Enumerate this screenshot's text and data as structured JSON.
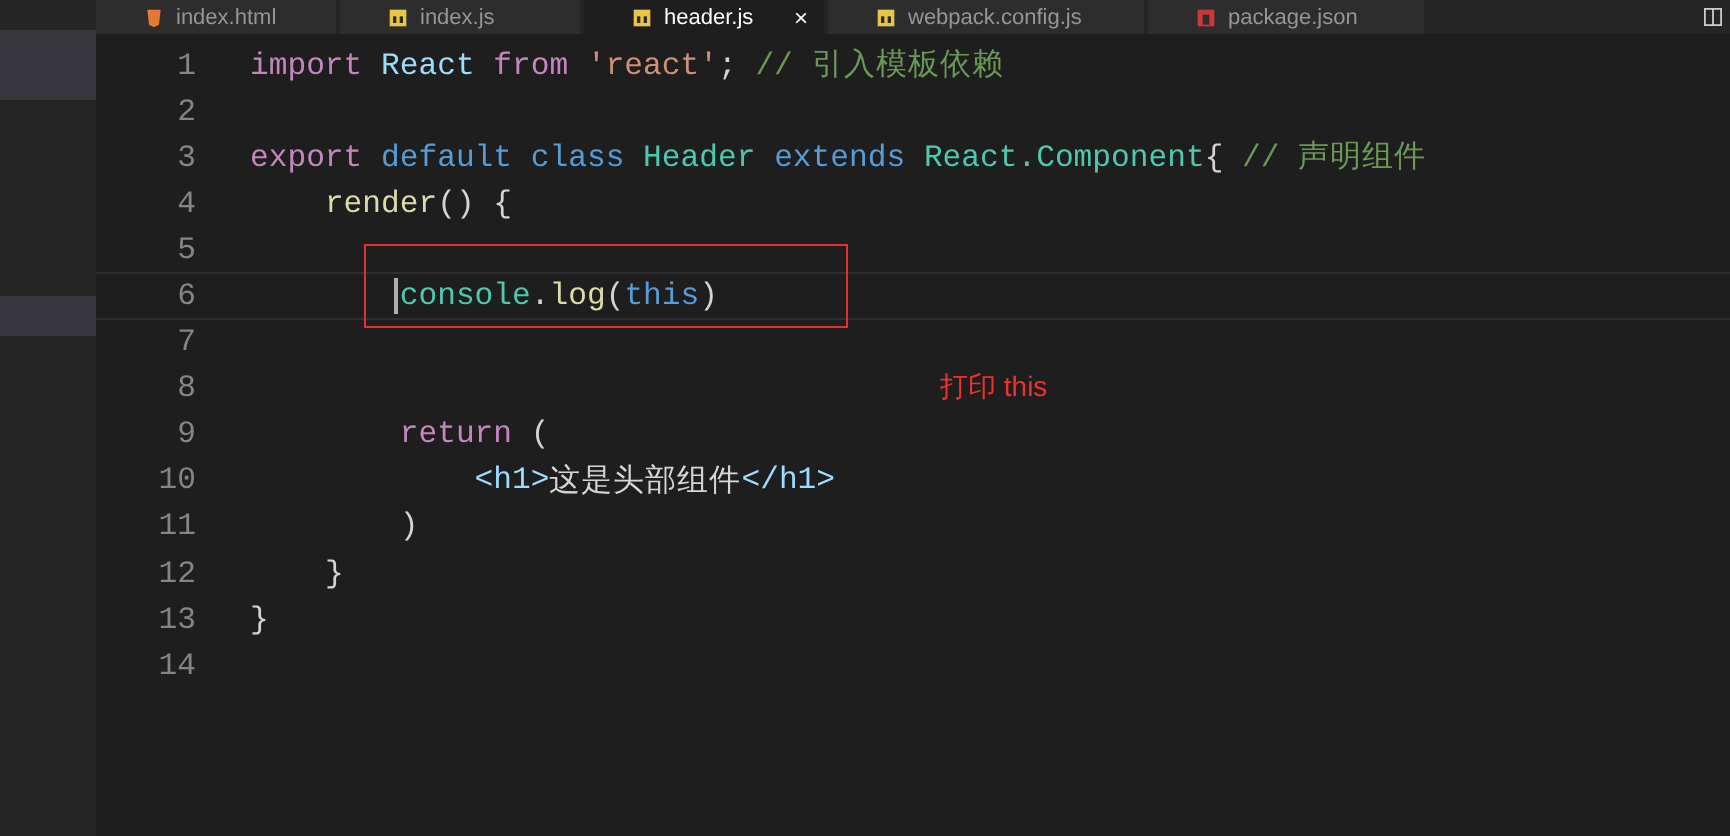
{
  "tabs": [
    {
      "label": "index.html",
      "selected": false,
      "closable": false
    },
    {
      "label": "index.js",
      "selected": false,
      "closable": false
    },
    {
      "label": "header.js",
      "selected": true,
      "closable": true
    },
    {
      "label": "webpack.config.js",
      "selected": false,
      "closable": false
    },
    {
      "label": "package.json",
      "selected": false,
      "closable": false
    }
  ],
  "close_glyph": "×",
  "lines": [
    {
      "number": "1",
      "current": false,
      "tokens": [
        {
          "text": "import ",
          "kind": "keyword"
        },
        {
          "text": "React ",
          "kind": "variable"
        },
        {
          "text": "from ",
          "kind": "keyword"
        },
        {
          "text": "'react'",
          "kind": "string"
        },
        {
          "text": "; ",
          "kind": "plain"
        },
        {
          "text": "// 引入模板依赖",
          "kind": "comment"
        }
      ]
    },
    {
      "number": "2",
      "current": false
    },
    {
      "number": "3",
      "current": false,
      "tokens": [
        {
          "text": "export ",
          "kind": "keyword"
        },
        {
          "text": "default ",
          "kind": "storage"
        },
        {
          "text": "class ",
          "kind": "storage"
        },
        {
          "text": "Header ",
          "kind": "type"
        },
        {
          "text": "extends ",
          "kind": "storage"
        },
        {
          "text": "React.Component",
          "kind": "type"
        },
        {
          "text": "{ ",
          "kind": "plain"
        },
        {
          "text": "// 声明组件",
          "kind": "comment"
        }
      ]
    },
    {
      "number": "4",
      "current": false,
      "tokens": [
        {
          "text": "    render",
          "kind": "function"
        },
        {
          "text": "() {",
          "kind": "plain"
        }
      ]
    },
    {
      "number": "5",
      "current": false
    },
    {
      "number": "6",
      "current": true,
      "tokens": [
        {
          "text": "        console",
          "kind": "type"
        },
        {
          "text": ".",
          "kind": "plain"
        },
        {
          "text": "log",
          "kind": "function"
        },
        {
          "text": "(",
          "kind": "plain"
        },
        {
          "text": "this",
          "kind": "storage"
        },
        {
          "text": ")",
          "kind": "plain"
        }
      ]
    },
    {
      "number": "7",
      "current": false
    },
    {
      "number": "8",
      "current": false
    },
    {
      "number": "9",
      "current": false,
      "tokens": [
        {
          "text": "        return",
          "kind": "keyword"
        },
        {
          "text": " (",
          "kind": "plain"
        }
      ]
    },
    {
      "number": "10",
      "current": false,
      "tokens": [
        {
          "text": "            <h1>",
          "kind": "tag"
        },
        {
          "text": "这是头部组件",
          "kind": "plain"
        },
        {
          "text": "</h1>",
          "kind": "tag"
        }
      ]
    },
    {
      "number": "11",
      "current": false,
      "tokens": [
        {
          "text": "        )",
          "kind": "plain"
        }
      ]
    },
    {
      "number": "12",
      "current": false,
      "tokens": [
        {
          "text": "    }",
          "kind": "plain"
        }
      ]
    },
    {
      "number": "13",
      "current": false,
      "tokens": [
        {
          "text": "}",
          "kind": "plain"
        }
      ]
    },
    {
      "number": "14",
      "current": false
    }
  ],
  "annotation": {
    "label": "打印 this"
  }
}
